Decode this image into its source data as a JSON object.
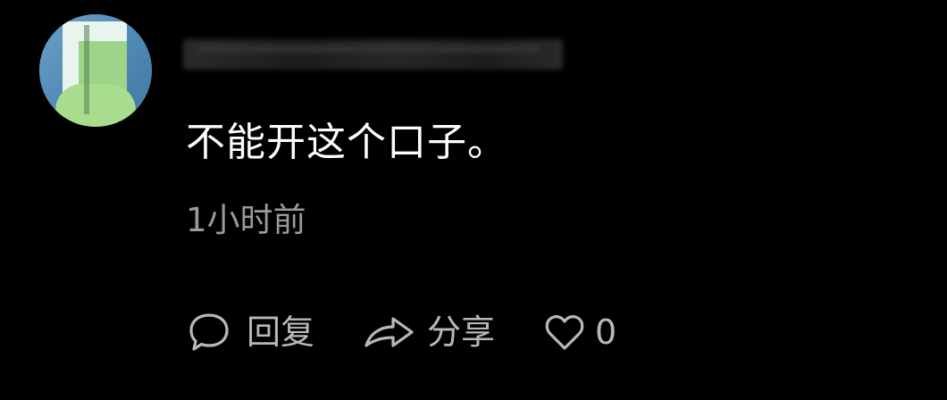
{
  "comment": {
    "text": "不能开这个口子。",
    "timestamp": "1小时前"
  },
  "actions": {
    "reply": {
      "icon": "speech-bubble-icon",
      "label": "回复"
    },
    "share": {
      "icon": "share-arrow-icon",
      "label": "分享"
    },
    "like": {
      "icon": "heart-icon",
      "count": "0"
    }
  },
  "colors": {
    "background": "#000000",
    "text": "#ffffff",
    "secondary_text": "#9a9a9a",
    "icon": "#b8b8b8"
  }
}
